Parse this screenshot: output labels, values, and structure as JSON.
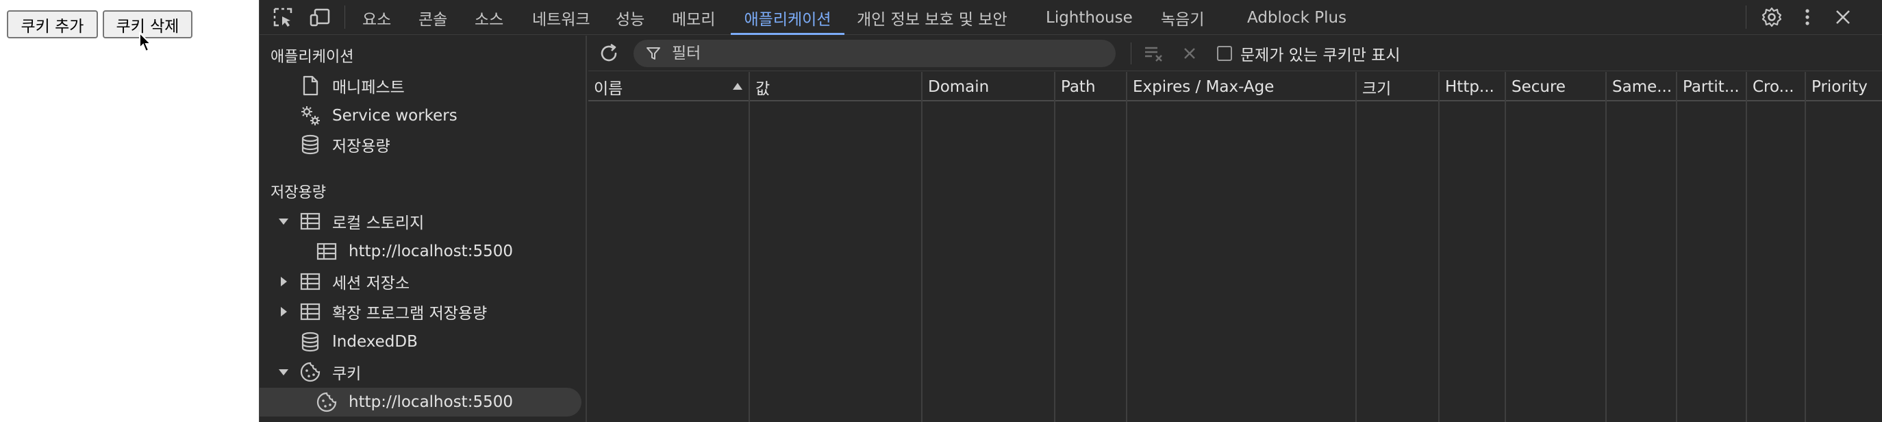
{
  "webpage": {
    "add_button": "쿠키 추가",
    "delete_button": "쿠키 삭제"
  },
  "tabs": [
    {
      "label": "요소"
    },
    {
      "label": "콘솔"
    },
    {
      "label": "소스"
    },
    {
      "label": "네트워크"
    },
    {
      "label": "성능"
    },
    {
      "label": "메모리"
    },
    {
      "label": "애플리케이션",
      "active": true
    },
    {
      "label": "개인 정보 보호 및 보안"
    },
    {
      "label": "Lighthouse"
    },
    {
      "label": "녹음기"
    },
    {
      "label": "Adblock Plus"
    }
  ],
  "sidebar": {
    "app_header": "애플리케이션",
    "app_items": [
      {
        "label": "매니페스트",
        "icon": "document-icon"
      },
      {
        "label": "Service workers",
        "icon": "gears-icon"
      },
      {
        "label": "저장용량",
        "icon": "database-icon"
      }
    ],
    "storage_header": "저장용량",
    "storage_items": [
      {
        "label": "로컬 스토리지",
        "icon": "table-icon",
        "expanded": true
      },
      {
        "label": "http://localhost:5500",
        "icon": "table-icon"
      },
      {
        "label": "세션 저장소",
        "icon": "table-icon",
        "expanded": false
      },
      {
        "label": "확장 프로그램 저장용량",
        "icon": "table-icon",
        "expanded": false
      },
      {
        "label": "IndexedDB",
        "icon": "database-icon"
      },
      {
        "label": "쿠키",
        "icon": "cookie-icon",
        "expanded": true
      },
      {
        "label": "http://localhost:5500",
        "icon": "cookie-icon",
        "selected": true
      }
    ]
  },
  "toolbar": {
    "filter_placeholder": "필터",
    "only_issues_label": "문제가 있는 쿠키만 표시"
  },
  "table": {
    "columns": [
      "이름",
      "값",
      "Domain",
      "Path",
      "Expires / Max-Age",
      "크기",
      "Http...",
      "Secure",
      "Same...",
      "Partit...",
      "Cro...",
      "Priority"
    ],
    "rows": []
  },
  "colors": {
    "accent": "#7cacf8",
    "panel_bg": "#282828",
    "text": "#e3e3e3"
  }
}
